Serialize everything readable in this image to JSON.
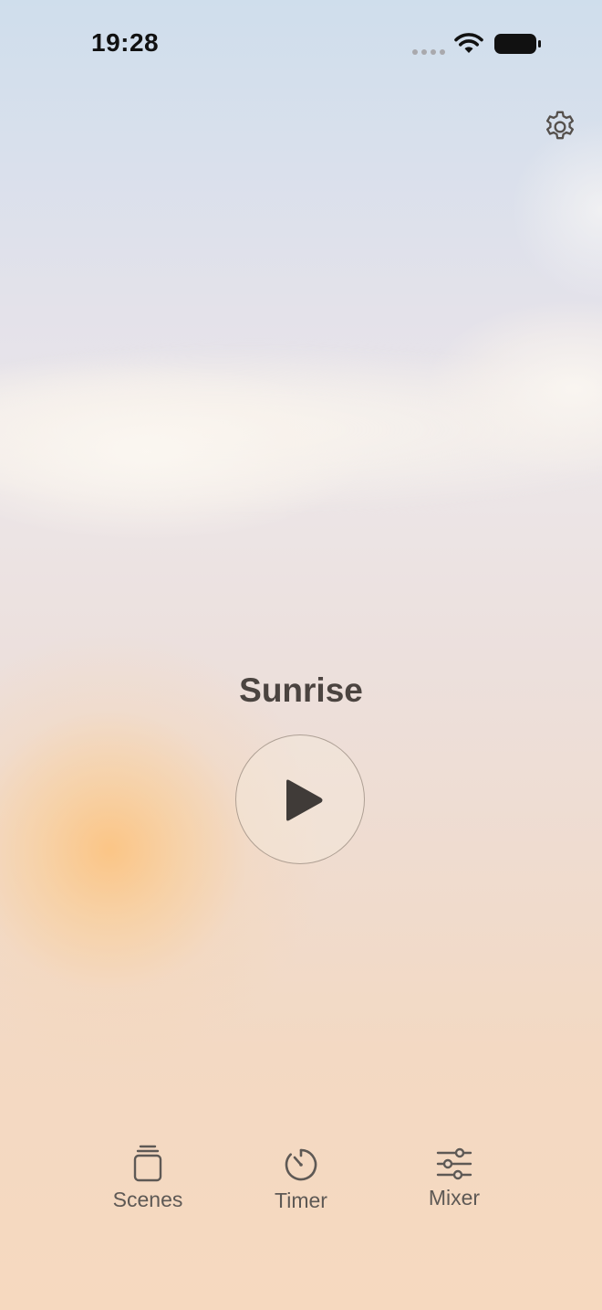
{
  "status_bar": {
    "time": "19:28"
  },
  "settings": {
    "icon": "gear-icon"
  },
  "scene": {
    "title": "Sunrise",
    "play_icon": "play-icon"
  },
  "tabs": [
    {
      "label": "Scenes",
      "icon": "scenes-icon"
    },
    {
      "label": "Timer",
      "icon": "timer-icon"
    },
    {
      "label": "Mixer",
      "icon": "mixer-icon"
    }
  ],
  "colors": {
    "text_dark": "#4b4440",
    "tab_text": "#5e5955",
    "sun": "#fcc482",
    "sky_top": "#cfdeec"
  }
}
